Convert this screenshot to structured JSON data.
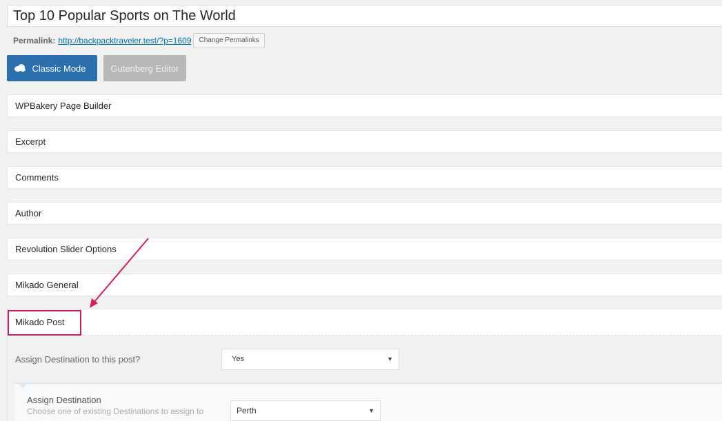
{
  "post": {
    "title": "Top 10 Popular Sports on The World",
    "permalink_label": "Permalink:",
    "permalink_url": "http://backpacktraveler.test/?p=1609",
    "change_permalinks_label": "Change Permalinks"
  },
  "editor_modes": {
    "classic_label": "Classic Mode",
    "gutenberg_label": "Gutenberg Editor",
    "classic_color": "#2c6fad",
    "gutenberg_color": "#b8b8b8"
  },
  "metaboxes": [
    {
      "label": "WPBakery Page Builder"
    },
    {
      "label": "Excerpt"
    },
    {
      "label": "Comments"
    },
    {
      "label": "Author"
    },
    {
      "label": "Revolution Slider Options"
    },
    {
      "label": "Mikado General"
    }
  ],
  "mikado_post": {
    "title": "Mikado Post",
    "assign_destination_question": "Assign Destination to this post?",
    "assign_destination_value": "Yes",
    "assign_destination_label": "Assign Destination",
    "assign_destination_desc": "Choose one of existing Destinations to assign to",
    "destination_value": "Perth",
    "highlight_color": "#d81e4f"
  },
  "icons": {
    "classic_mode_icon": "cloud-icon",
    "select_arrow": "caret-down-icon",
    "annotation_arrow": "arrow-annotation"
  }
}
